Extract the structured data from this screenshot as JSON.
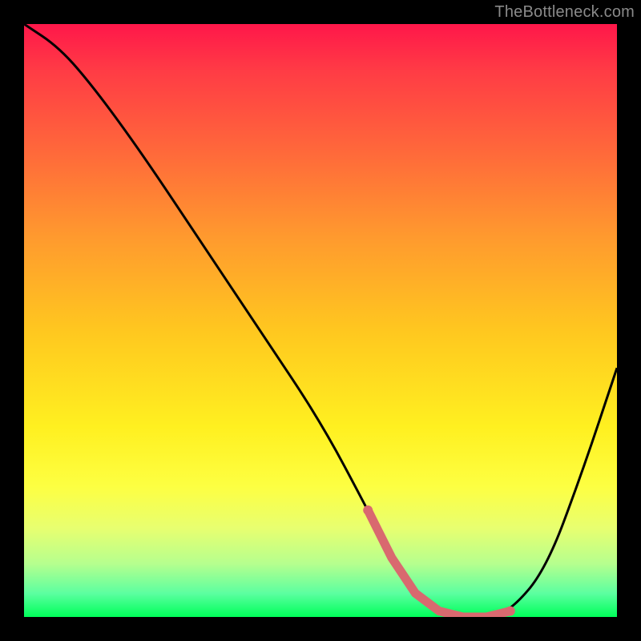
{
  "watermark": "TheBottleneck.com",
  "chart_data": {
    "type": "line",
    "title": "",
    "xlabel": "",
    "ylabel": "",
    "xlim": [
      0,
      100
    ],
    "ylim": [
      0,
      100
    ],
    "series": [
      {
        "name": "bottleneck-curve",
        "x": [
          0,
          6,
          12,
          20,
          30,
          40,
          50,
          58,
          62,
          66,
          70,
          74,
          78,
          82,
          88,
          94,
          100
        ],
        "values": [
          100,
          96,
          89,
          78,
          63,
          48,
          33,
          18,
          10,
          4,
          1,
          0,
          0,
          1,
          8,
          24,
          42
        ]
      }
    ],
    "highlight": {
      "name": "optimal-range",
      "x_range": [
        58,
        82
      ],
      "color": "#d9696f"
    },
    "gradient_stops": [
      {
        "pos": 0.0,
        "color": "#ff174a"
      },
      {
        "pos": 0.22,
        "color": "#ff6a3a"
      },
      {
        "pos": 0.52,
        "color": "#ffc81f"
      },
      {
        "pos": 0.78,
        "color": "#fdff42"
      },
      {
        "pos": 1.0,
        "color": "#00ff5a"
      }
    ]
  }
}
